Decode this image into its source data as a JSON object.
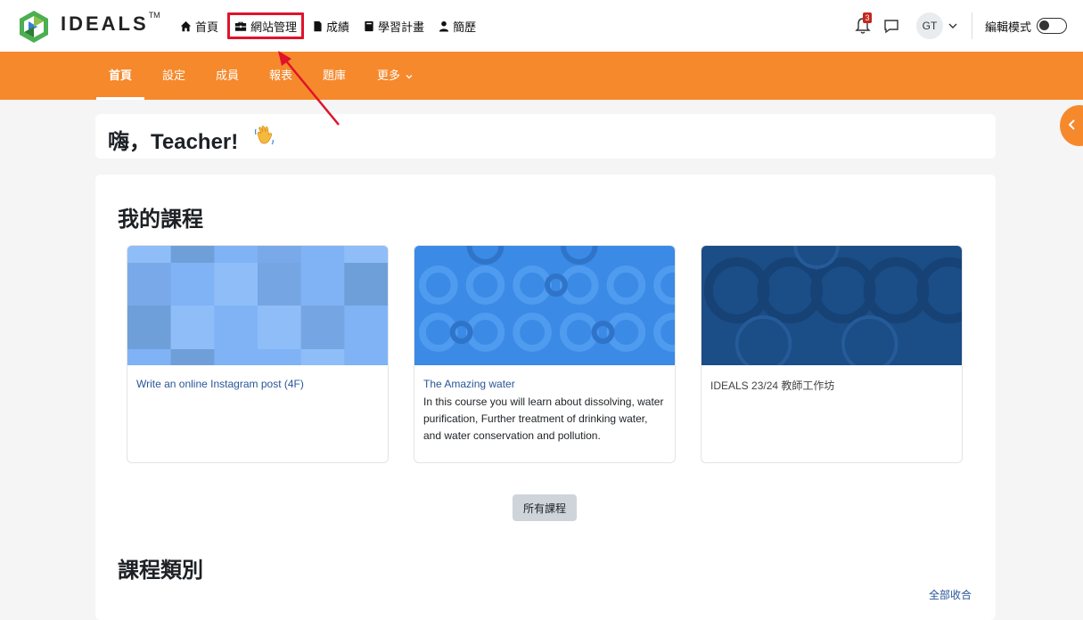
{
  "header": {
    "brand": "IDEALS",
    "trademark": "TM",
    "nav": [
      {
        "label": "首頁",
        "icon": "home-icon"
      },
      {
        "label": "網站管理",
        "icon": "toolbox-icon"
      },
      {
        "label": "成績",
        "icon": "file-icon"
      },
      {
        "label": "學習計畫",
        "icon": "book-icon"
      },
      {
        "label": "簡歷",
        "icon": "user-icon"
      }
    ],
    "notification_count": "3",
    "user_initials": "GT",
    "edit_mode_label": "編輯模式"
  },
  "subnav": {
    "tabs": [
      {
        "label": "首頁",
        "active": true
      },
      {
        "label": "設定"
      },
      {
        "label": "成員"
      },
      {
        "label": "報表"
      },
      {
        "label": "題庫"
      },
      {
        "label": "更多"
      }
    ]
  },
  "greeting": "嗨，Teacher!",
  "my_courses": {
    "heading": "我的課程",
    "courses": [
      {
        "title": "Write an online Instagram post (4F)",
        "summary": ""
      },
      {
        "title": "The Amazing water",
        "summary": "In this course you will learn about dissolving, water purification, Further treatment of drinking water, and water conservation and pollution."
      },
      {
        "title": "IDEALS 23/24 教師工作坊",
        "summary": ""
      }
    ],
    "all_courses_label": "所有課程"
  },
  "categories": {
    "heading": "課程類別",
    "collapse_all_label": "全部收合"
  },
  "colors": {
    "accent": "#f6892c",
    "highlight": "#e0132b",
    "link": "#2a5598"
  }
}
